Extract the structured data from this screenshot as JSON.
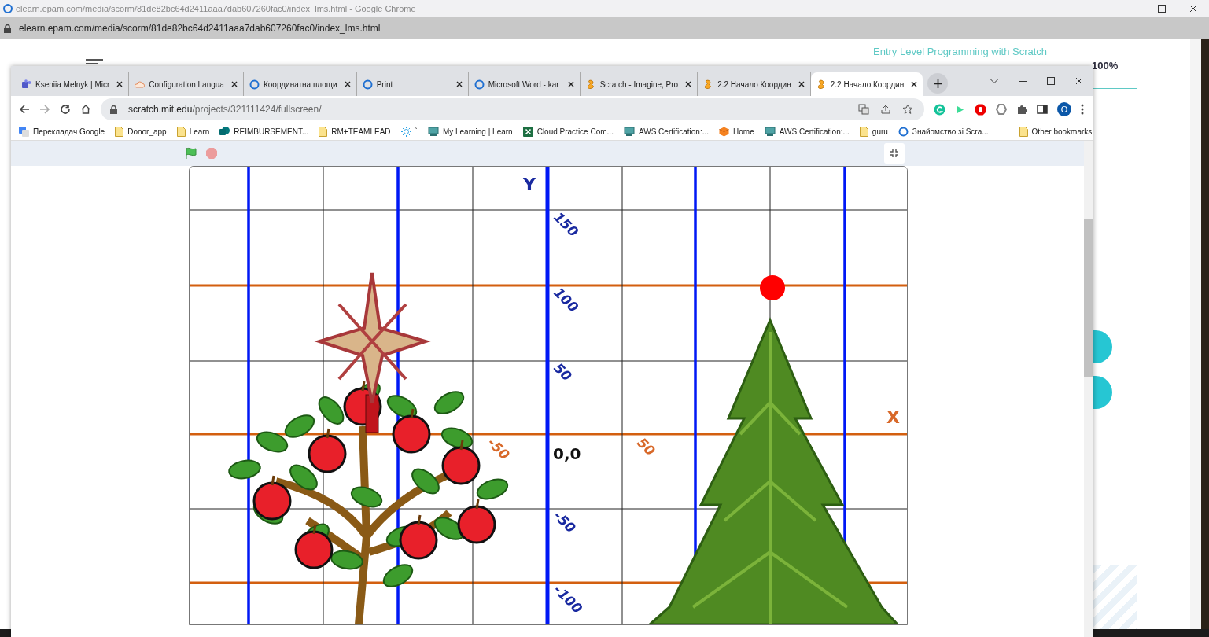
{
  "outer_window": {
    "title": "elearn.epam.com/media/scorm/81de82bc64d2411aaa7dab607260fac0/index_lms.html - Google Chrome",
    "url": "elearn.epam.com/media/scorm/81de82bc64d2411aaa7dab607260fac0/index_lms.html"
  },
  "course_page": {
    "course_title": "Entry Level Programming with Scratch",
    "progress": "100%",
    "level": 1
  },
  "browser": {
    "tabs": [
      {
        "label": "Kseniia Melnyk | Micr",
        "kind": "teams",
        "selected": false
      },
      {
        "label": "Configuration Langua",
        "kind": "cloud",
        "selected": false
      },
      {
        "label": "Координатна площи",
        "kind": "ring",
        "selected": false
      },
      {
        "label": "Print",
        "kind": "ring",
        "selected": false
      },
      {
        "label": "Microsoft Word - kar",
        "kind": "ring",
        "selected": false
      },
      {
        "label": "Scratch - Imagine, Pro",
        "kind": "scratch",
        "selected": false
      },
      {
        "label": "2.2 Начало Координ",
        "kind": "scratch",
        "selected": false
      },
      {
        "label": "2.2 Начало Координ",
        "kind": "scratch",
        "selected": true
      }
    ],
    "url_host": "scratch.mit.edu",
    "url_path": "/projects/321111424/fullscreen/",
    "profile_initial": "O",
    "bookmarks": [
      {
        "label": "Перекладач Google",
        "kind": "translate"
      },
      {
        "label": "Donor_app",
        "kind": "folder"
      },
      {
        "label": "Learn",
        "kind": "folder"
      },
      {
        "label": "REIMBURSEMENT...",
        "kind": "sharepoint"
      },
      {
        "label": "RM+TEAMLEAD",
        "kind": "folder"
      },
      {
        "label": "`",
        "kind": "sun"
      },
      {
        "label": "My Learning | Learn",
        "kind": "monitor"
      },
      {
        "label": "Cloud Practice Com...",
        "kind": "excel"
      },
      {
        "label": "AWS Certification:...",
        "kind": "monitor"
      },
      {
        "label": "Home",
        "kind": "cube"
      },
      {
        "label": "AWS Certification:...",
        "kind": "monitor"
      },
      {
        "label": "guru",
        "kind": "folder"
      },
      {
        "label": "Знайомство зі Scra...",
        "kind": "ring"
      }
    ],
    "other_bookmarks": "Other bookmarks"
  },
  "stage": {
    "y_axis_label": "Y",
    "x_axis_label": "X",
    "origin_label": "0,0",
    "y_ticks": [
      "150",
      "100",
      "50",
      "-50",
      "-100"
    ],
    "x_ticks": [
      "-50",
      "50"
    ]
  }
}
